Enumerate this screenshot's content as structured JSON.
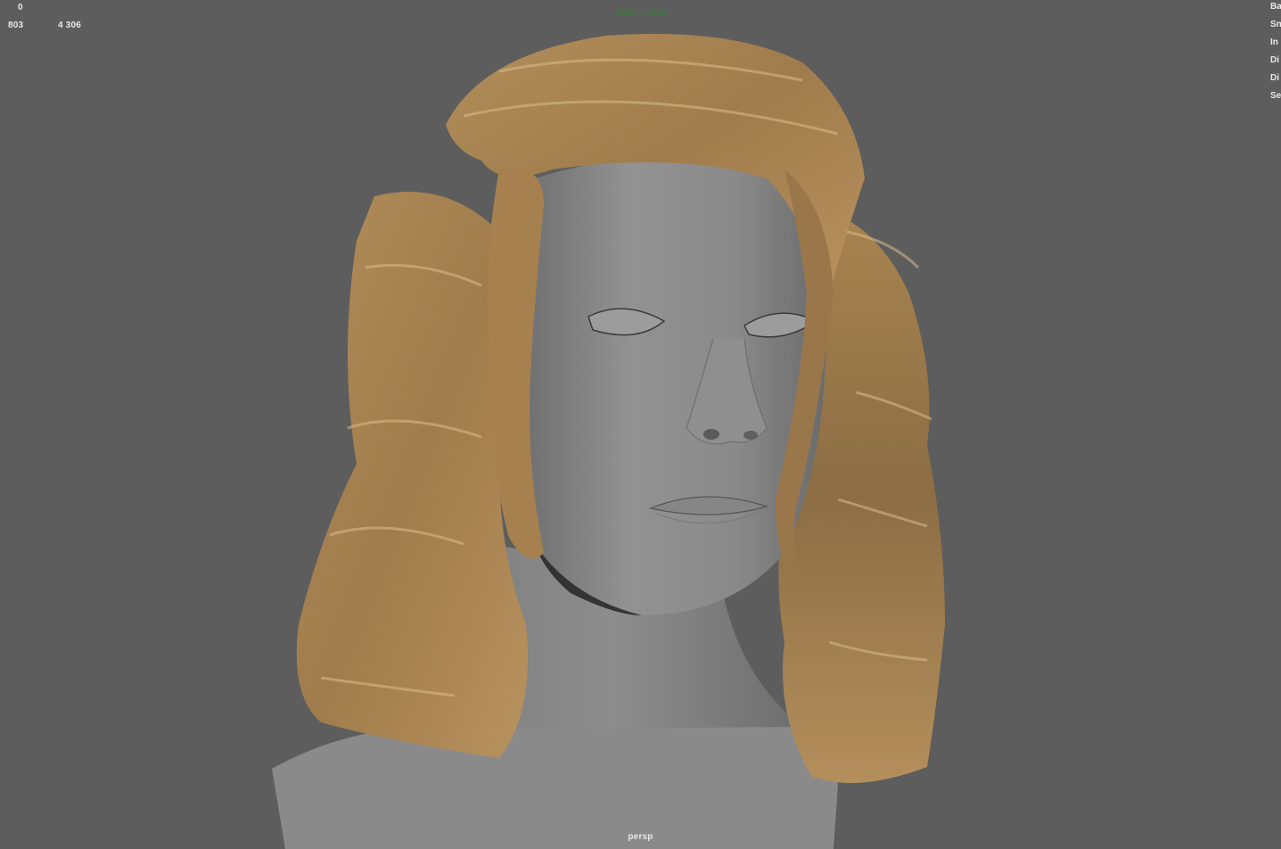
{
  "viewport": {
    "background": "#5d5d5d",
    "hair_color": "#a88454",
    "skin_color": "#8c8c8c"
  },
  "hud": {
    "top_left_value": "0",
    "second_row_left": "803",
    "second_row_right": "4 306",
    "resolution": "2000 x 2000",
    "camera_name": "persp",
    "right_labels": [
      "Ba",
      "Sn",
      "In",
      "Di",
      "Di",
      "Se"
    ]
  },
  "scene": {
    "object": "head-bust-with-hair"
  }
}
